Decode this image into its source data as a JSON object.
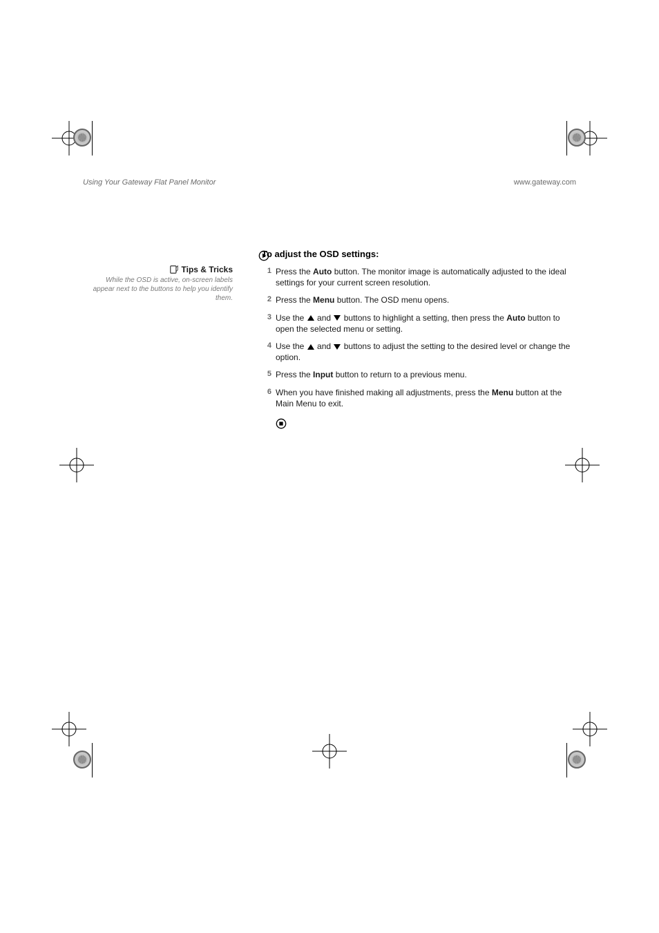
{
  "header": {
    "left": "Using Your Gateway Flat Panel Monitor",
    "right": "www.gateway.com"
  },
  "tips": {
    "label": "Tips & Tricks",
    "body": "While the OSD is active, on-screen labels appear next to the buttons to help you identify them."
  },
  "title": "To adjust the OSD settings:",
  "steps": [
    {
      "n": "1",
      "pre": "Press the ",
      "b1": "Auto",
      "post": " button. The monitor image is automatically adjusted to the ideal settings for your current screen resolution."
    },
    {
      "n": "2",
      "pre": "Press the ",
      "b1": "Menu",
      "post": " button. The OSD menu opens."
    },
    {
      "n": "3",
      "pre": "Use the ",
      "tri": true,
      "mid": " buttons to highlight a setting, then press the ",
      "b1": "Auto",
      "post": " button to open the selected menu or setting."
    },
    {
      "n": "4",
      "pre": "Use the ",
      "tri": true,
      "mid": " buttons to adjust the setting to the desired level or change the option."
    },
    {
      "n": "5",
      "pre": "Press the ",
      "b1": "Input",
      "post": " button to return to a previous menu."
    },
    {
      "n": "6",
      "pre": "When you have finished making all adjustments, press the ",
      "b1": "Menu",
      "post": " button at the Main Menu to exit."
    }
  ]
}
